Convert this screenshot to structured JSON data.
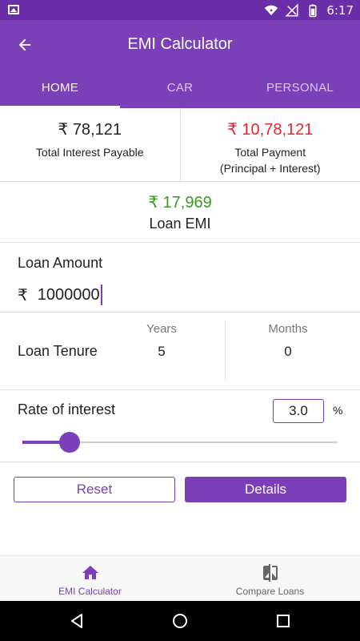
{
  "statusbar": {
    "time": "6:17",
    "icons": [
      "image-icon",
      "wifi-icon",
      "signal-icon",
      "battery-icon"
    ]
  },
  "appbar": {
    "title": "EMI Calculator",
    "back_icon": "arrow-left-icon"
  },
  "tabs": [
    {
      "label": "HOME",
      "active": true
    },
    {
      "label": "CAR",
      "active": false
    },
    {
      "label": "PERSONAL",
      "active": false
    }
  ],
  "summary": {
    "interest": {
      "amount": "₹ 78,121",
      "label": "Total Interest Payable"
    },
    "payment": {
      "amount": "₹ 10,78,121",
      "label": "Total Payment",
      "sublabel": "(Principal + Interest)"
    }
  },
  "emi": {
    "amount": "₹ 17,969",
    "label": "Loan EMI"
  },
  "loan_amount": {
    "label": "Loan Amount",
    "currency": "₹",
    "value": "1000000"
  },
  "tenure": {
    "label": "Loan Tenure",
    "years_header": "Years",
    "years_value": "5",
    "months_header": "Months",
    "months_value": "0"
  },
  "rate": {
    "label": "Rate of interest",
    "value": "3.0",
    "unit": "%",
    "slider_fraction": 0.15
  },
  "buttons": {
    "reset": "Reset",
    "details": "Details"
  },
  "bottom_nav": [
    {
      "label": "EMI Calculator",
      "icon": "home-icon",
      "active": true
    },
    {
      "label": "Compare Loans",
      "icon": "compare-icon",
      "active": false
    }
  ],
  "colors": {
    "primary": "#7b3fb7",
    "status_bar": "#6a2ea8",
    "red": "#e8262c",
    "green": "#3a9a1e"
  }
}
